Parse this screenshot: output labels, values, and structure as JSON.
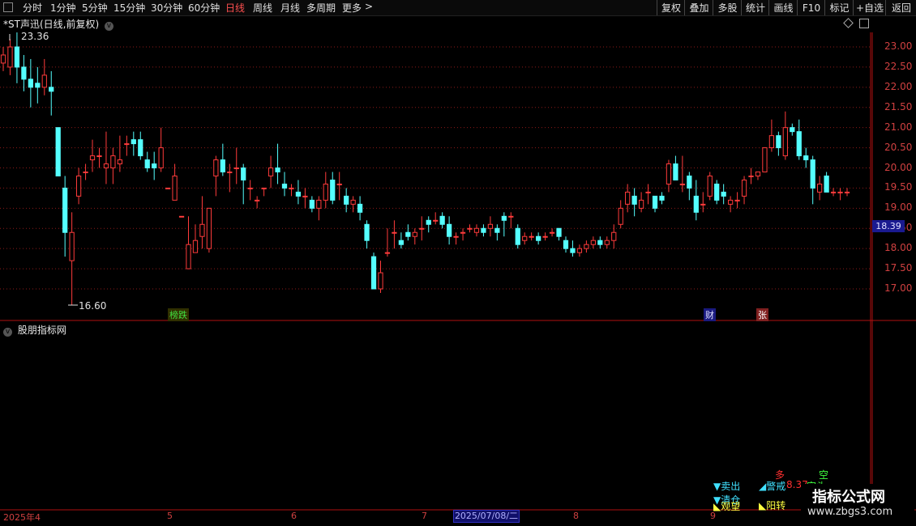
{
  "toolbar": {
    "periods": [
      "分时",
      "1分钟",
      "5分钟",
      "15分钟",
      "30分钟",
      "60分钟",
      "日线",
      "周线",
      "月线",
      "多周期",
      "更多"
    ],
    "active_period": "日线",
    "right_buttons": [
      "复权",
      "叠加",
      "多股",
      "统计",
      "画线",
      "F10",
      "标记",
      "+自选",
      "返回"
    ]
  },
  "stock": {
    "title": "*ST声迅(日线,前复权)",
    "current_price_label": "18.39",
    "high_marker": "23.36",
    "low_marker": "16.60"
  },
  "panel2": {
    "title": "股朋指标网"
  },
  "cursor_date": "2025/07/08/二",
  "badges": [
    {
      "text": "榜跌",
      "color": "#40e040",
      "bg": "#303000"
    },
    {
      "text": "财",
      "color": "#e0e0ff",
      "bg": "#1a1a80"
    },
    {
      "text": "张",
      "color": "#ffffff",
      "bg": "#802020"
    }
  ],
  "signals": {
    "sell": "▼卖出",
    "clear": "▼清仓",
    "watch": "◣观望",
    "warn": "◢警戒",
    "yang": "◣阳转",
    "duo": "多",
    "kong": "空",
    "kong_head": "空头",
    "value": "8.37"
  },
  "watermark": {
    "title": "指标公式网",
    "url": "www.zbgs3.com"
  },
  "colors": {
    "up": "#ff3b3b",
    "down": "#54ffff",
    "grid": "#8b1a1a",
    "axis": "#b01010"
  },
  "chart_data": {
    "type": "candlestick",
    "title": "*ST声迅(日线,前复权)",
    "ylim": [
      16.6,
      23.36
    ],
    "y_ticks": [
      17.0,
      17.5,
      18.0,
      18.5,
      19.0,
      19.5,
      20.0,
      20.5,
      21.0,
      21.5,
      22.0,
      22.5,
      23.0
    ],
    "x_ticks": [
      "2025年4",
      "5",
      "6",
      "7",
      "8",
      "9"
    ],
    "grid": true,
    "candles": [
      [
        22.6,
        23.0,
        22.8,
        22.4
      ],
      [
        22.5,
        23.2,
        23.0,
        22.3
      ],
      [
        23.0,
        23.36,
        22.5,
        22.1
      ],
      [
        22.5,
        22.8,
        22.2,
        21.9
      ],
      [
        22.2,
        22.7,
        22.0,
        21.5
      ],
      [
        22.1,
        22.5,
        22.0,
        21.6
      ],
      [
        22.0,
        22.7,
        22.3,
        21.8
      ],
      [
        22.0,
        22.4,
        21.9,
        21.3
      ],
      [
        21.0,
        21.0,
        19.8,
        19.8
      ],
      [
        19.5,
        19.8,
        18.4,
        17.8
      ],
      [
        17.7,
        18.9,
        18.4,
        16.6
      ],
      [
        19.3,
        20.0,
        19.8,
        19.1
      ],
      [
        19.9,
        20.1,
        19.9,
        19.7
      ],
      [
        20.2,
        20.7,
        20.3,
        19.9
      ],
      [
        20.3,
        20.5,
        20.3,
        20.0
      ],
      [
        20.0,
        20.9,
        20.1,
        19.6
      ],
      [
        20.0,
        20.5,
        20.3,
        19.6
      ],
      [
        20.1,
        20.8,
        20.2,
        19.9
      ],
      [
        20.6,
        20.8,
        20.6,
        20.3
      ],
      [
        20.7,
        20.9,
        20.6,
        20.3
      ],
      [
        20.7,
        20.9,
        20.3,
        20.2
      ],
      [
        20.2,
        20.4,
        20.0,
        19.9
      ],
      [
        20.1,
        20.4,
        20.0,
        19.7
      ],
      [
        20.0,
        21.0,
        20.5,
        19.9
      ],
      [
        19.5,
        19.5,
        19.5,
        19.5
      ],
      [
        19.2,
        20.1,
        19.8,
        19.2
      ],
      [
        18.8,
        18.8,
        18.8,
        18.8
      ],
      [
        17.5,
        18.8,
        18.1,
        17.5
      ],
      [
        17.9,
        18.6,
        18.2,
        17.9
      ],
      [
        18.3,
        19.3,
        18.6,
        18.0
      ],
      [
        18.0,
        19.0,
        19.0,
        17.9
      ],
      [
        19.8,
        20.3,
        20.2,
        19.3
      ],
      [
        20.2,
        20.6,
        19.9,
        19.8
      ],
      [
        19.9,
        20.1,
        19.9,
        19.4
      ],
      [
        20.0,
        20.5,
        20.0,
        19.6
      ],
      [
        20.0,
        20.1,
        19.7,
        19.1
      ],
      [
        19.5,
        19.7,
        19.5,
        19.2
      ],
      [
        19.2,
        19.3,
        19.2,
        19.0
      ],
      [
        19.5,
        19.5,
        19.5,
        19.3
      ],
      [
        19.8,
        20.3,
        20.0,
        19.5
      ],
      [
        20.0,
        20.6,
        19.9,
        19.6
      ],
      [
        19.6,
        19.9,
        19.5,
        19.3
      ],
      [
        19.5,
        19.6,
        19.5,
        19.3
      ],
      [
        19.4,
        19.7,
        19.3,
        19.1
      ],
      [
        19.3,
        19.5,
        19.3,
        19.0
      ],
      [
        19.2,
        19.3,
        19.0,
        18.9
      ],
      [
        19.0,
        19.3,
        19.2,
        18.7
      ],
      [
        19.2,
        19.9,
        19.6,
        19.0
      ],
      [
        19.7,
        19.9,
        19.2,
        19.1
      ],
      [
        19.6,
        19.9,
        19.6,
        19.2
      ],
      [
        19.3,
        19.5,
        19.1,
        18.9
      ],
      [
        19.1,
        19.3,
        19.2,
        18.9
      ],
      [
        19.1,
        19.3,
        18.9,
        18.7
      ],
      [
        18.6,
        18.7,
        18.2,
        18.0
      ],
      [
        17.8,
        17.9,
        17.0,
        17.0
      ],
      [
        17.0,
        17.7,
        17.4,
        16.9
      ],
      [
        17.9,
        18.5,
        17.9,
        17.8
      ],
      [
        18.4,
        18.7,
        18.4,
        18.0
      ],
      [
        18.2,
        18.4,
        18.1,
        18.0
      ],
      [
        18.4,
        18.6,
        18.3,
        18.2
      ],
      [
        18.3,
        18.5,
        18.4,
        18.1
      ],
      [
        18.5,
        18.8,
        18.5,
        18.2
      ],
      [
        18.7,
        18.8,
        18.6,
        18.4
      ],
      [
        18.7,
        18.9,
        18.7,
        18.6
      ],
      [
        18.8,
        18.9,
        18.6,
        18.5
      ],
      [
        18.6,
        18.8,
        18.3,
        18.1
      ],
      [
        18.3,
        18.4,
        18.3,
        18.1
      ],
      [
        18.4,
        18.5,
        18.4,
        18.2
      ],
      [
        18.5,
        18.6,
        18.5,
        18.4
      ],
      [
        18.4,
        18.6,
        18.5,
        18.3
      ],
      [
        18.5,
        18.6,
        18.4,
        18.3
      ],
      [
        18.5,
        18.8,
        18.6,
        18.3
      ],
      [
        18.5,
        18.6,
        18.4,
        18.2
      ],
      [
        18.8,
        18.9,
        18.7,
        18.3
      ],
      [
        18.8,
        18.9,
        18.8,
        18.5
      ],
      [
        18.5,
        18.6,
        18.1,
        18.0
      ],
      [
        18.2,
        18.4,
        18.3,
        18.1
      ],
      [
        18.3,
        18.4,
        18.3,
        18.2
      ],
      [
        18.3,
        18.4,
        18.2,
        18.1
      ],
      [
        18.3,
        18.4,
        18.3,
        18.2
      ],
      [
        18.4,
        18.5,
        18.4,
        18.3
      ],
      [
        18.5,
        18.5,
        18.3,
        18.2
      ],
      [
        18.2,
        18.3,
        18.0,
        17.9
      ],
      [
        18.0,
        18.2,
        17.9,
        17.8
      ],
      [
        17.9,
        18.1,
        18.0,
        17.8
      ],
      [
        18.0,
        18.2,
        18.1,
        17.9
      ],
      [
        18.1,
        18.3,
        18.2,
        18.0
      ],
      [
        18.2,
        18.3,
        18.1,
        18.0
      ],
      [
        18.1,
        18.3,
        18.2,
        18.0
      ],
      [
        18.2,
        18.6,
        18.4,
        18.0
      ],
      [
        18.6,
        19.2,
        19.0,
        18.5
      ],
      [
        19.1,
        19.6,
        19.4,
        18.9
      ],
      [
        19.3,
        19.5,
        19.1,
        18.8
      ],
      [
        19.0,
        19.4,
        19.2,
        18.9
      ],
      [
        19.4,
        19.6,
        19.4,
        19.1
      ],
      [
        19.3,
        19.3,
        19.0,
        18.9
      ],
      [
        19.3,
        19.4,
        19.2,
        19.1
      ],
      [
        19.6,
        20.2,
        20.1,
        19.4
      ],
      [
        20.1,
        20.3,
        19.7,
        19.7
      ],
      [
        19.6,
        20.3,
        19.6,
        19.4
      ],
      [
        19.8,
        19.9,
        19.5,
        19.2
      ],
      [
        19.3,
        19.7,
        18.9,
        18.7
      ],
      [
        19.1,
        19.4,
        19.1,
        18.9
      ],
      [
        19.3,
        19.9,
        19.8,
        19.2
      ],
      [
        19.6,
        19.7,
        19.2,
        19.1
      ],
      [
        19.4,
        19.6,
        19.3,
        19.1
      ],
      [
        19.1,
        19.3,
        19.2,
        18.9
      ],
      [
        19.2,
        19.4,
        19.2,
        19.0
      ],
      [
        19.3,
        19.8,
        19.7,
        19.1
      ],
      [
        19.8,
        20.0,
        19.8,
        19.6
      ],
      [
        19.8,
        19.9,
        19.9,
        19.7
      ],
      [
        19.9,
        20.5,
        20.5,
        19.9
      ],
      [
        20.5,
        21.2,
        20.8,
        20.4
      ],
      [
        20.8,
        20.9,
        20.5,
        20.3
      ],
      [
        20.3,
        21.4,
        21.0,
        20.2
      ],
      [
        21.0,
        21.1,
        20.9,
        20.8
      ],
      [
        20.9,
        21.2,
        20.3,
        20.2
      ],
      [
        20.3,
        20.5,
        20.2,
        20.0
      ],
      [
        20.2,
        20.3,
        19.5,
        19.1
      ],
      [
        19.4,
        19.8,
        19.6,
        19.2
      ],
      [
        19.8,
        19.9,
        19.4,
        19.4
      ],
      [
        19.4,
        19.5,
        19.4,
        19.3
      ],
      [
        19.4,
        19.5,
        19.4,
        19.2
      ],
      [
        19.4,
        19.5,
        19.4,
        19.3
      ]
    ]
  }
}
